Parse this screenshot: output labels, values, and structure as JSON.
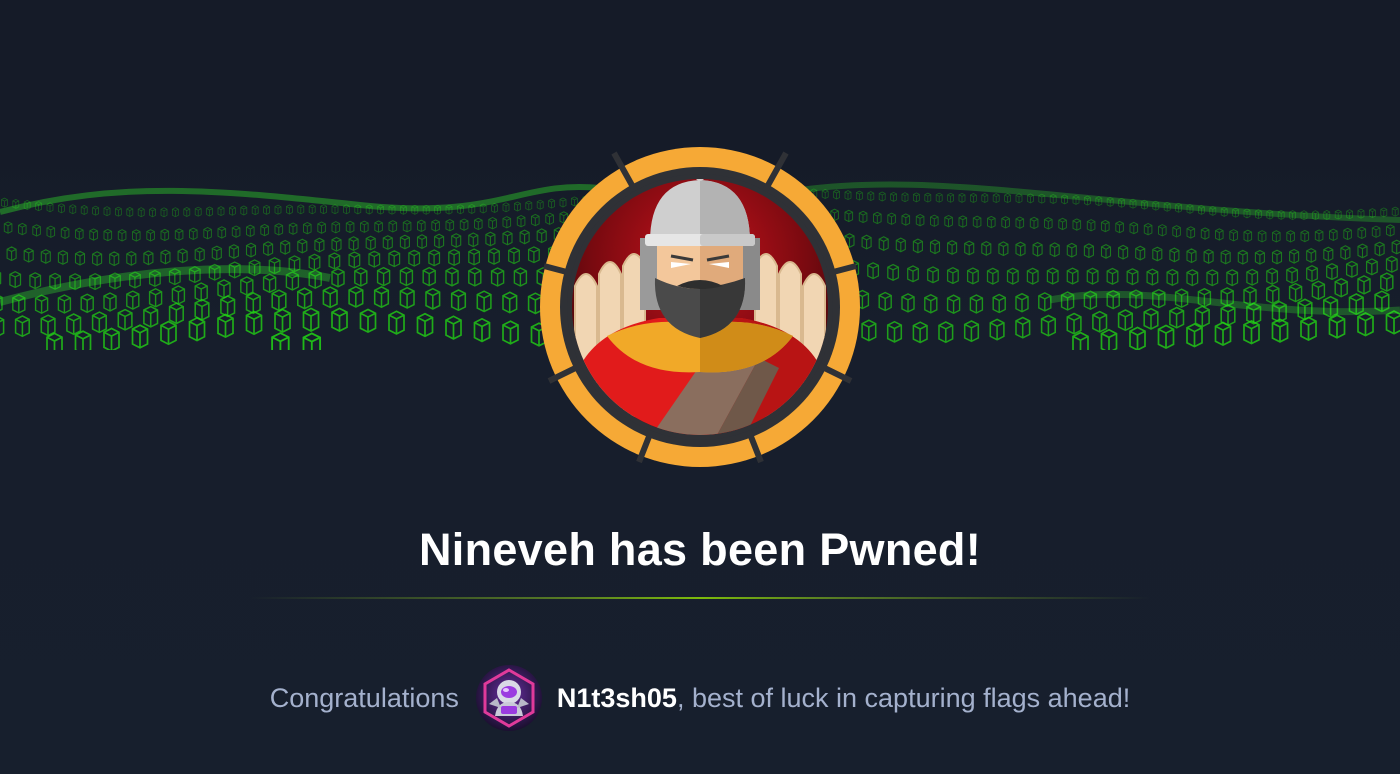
{
  "pwn": {
    "machine_name": "Nineveh",
    "title": "Nineveh has been Pwned!",
    "congrats_label": "Congratulations",
    "username": "N1t3sh05",
    "message": ", best of luck in capturing flags ahead!"
  },
  "colors": {
    "background": "#171f2d",
    "title": "#ffffff",
    "text": "#a4b1cd",
    "accent_green": "#9fef00",
    "grid_green": "#22d914",
    "avatar_ring": "#f6a936"
  },
  "icons": {
    "banner": "green-cube-wave-banner",
    "machine_avatar": "helmeted-warrior-machine-avatar",
    "user_avatar": "astronaut-user-avatar"
  }
}
